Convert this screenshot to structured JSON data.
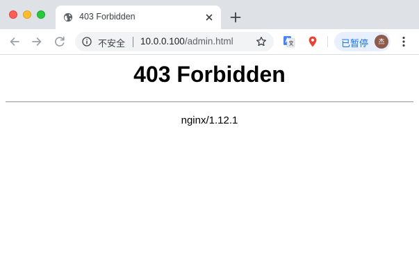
{
  "tab": {
    "title": "403 Forbidden"
  },
  "toolbar": {
    "security_label": "不安全",
    "url_host": "10.0.0.100",
    "url_path": "/admin.html",
    "paused_label": "已暂停",
    "avatar_text": "杰"
  },
  "page": {
    "heading": "403 Forbidden",
    "server": "nginx/1.12.1"
  },
  "colors": {
    "tabstrip_bg": "#dee1e6",
    "omnibox_bg": "#f1f3f4",
    "accent_blue": "#1a73e8",
    "traffic_close": "#fe5f57",
    "traffic_min": "#febc2e",
    "traffic_max": "#28c840"
  },
  "icons": {
    "tab_favicon": "globe-icon",
    "tab_close": "close-icon",
    "new_tab": "plus-icon",
    "back": "arrow-left-icon",
    "forward": "arrow-right-icon",
    "reload": "reload-icon",
    "site_info": "info-icon",
    "bookmark": "star-icon",
    "translate": "google-translate-icon",
    "maps": "map-pin-icon",
    "menu": "more-vertical-icon"
  }
}
